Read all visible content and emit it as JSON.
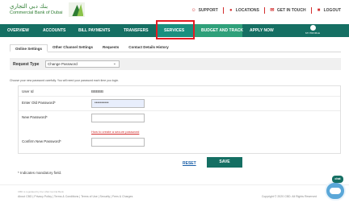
{
  "brand": {
    "arabic_name": "بنك دبي التجاري",
    "english_name": "Commercial Bank of Dubai"
  },
  "toplinks": {
    "support": "SUPPORT",
    "locations": "LOCATIONS",
    "get_in_touch": "GET IN TOUCH",
    "logout": "LOGOUT"
  },
  "nav": {
    "items": [
      {
        "label": "OVERVIEW"
      },
      {
        "label": "ACCOUNTS"
      },
      {
        "label": "BILL PAYMENTS"
      },
      {
        "label": "TRANSFERS"
      },
      {
        "label": "SERVICES"
      },
      {
        "label": "BUDGET AND TRACK"
      },
      {
        "label": "APPLY NOW"
      }
    ],
    "profile_label": "MY PROFILE"
  },
  "subtabs": [
    {
      "label": "Online Settings"
    },
    {
      "label": "Other Channel Settings"
    },
    {
      "label": "Requests"
    },
    {
      "label": "Contact Details History"
    }
  ],
  "request": {
    "label": "Request Type",
    "selected": "Change Password"
  },
  "instruction": "Choose your new password carefully. You will need your password each time you login.",
  "form": {
    "user_id_label": "User Id",
    "user_id_value": "BBBBB",
    "old_password_label": "Enter Old Password*",
    "old_password_value": "••••••••••",
    "new_password_label": "New Password*",
    "new_password_value": "",
    "secure_link": "How to create a secure password",
    "confirm_label": "Confirm New Password*",
    "confirm_value": ""
  },
  "actions": {
    "reset": "RESET",
    "save": "SAVE"
  },
  "mandatory_note": "* Indicates mandatory field.",
  "footer": {
    "notice": "CBD is regulated by the UAE Central Bank",
    "links": "About CBD | Privacy Policy | Terms & Conditions | Terms of Use | Security | Fees & Charges",
    "copyright": "Copyright © 2020 CBD. All Rights Reserved"
  },
  "chat": {
    "badge": "chat"
  },
  "colors": {
    "brand_green": "#156f63",
    "highlight_red": "#e31b23",
    "link_red": "#d32f2f"
  }
}
